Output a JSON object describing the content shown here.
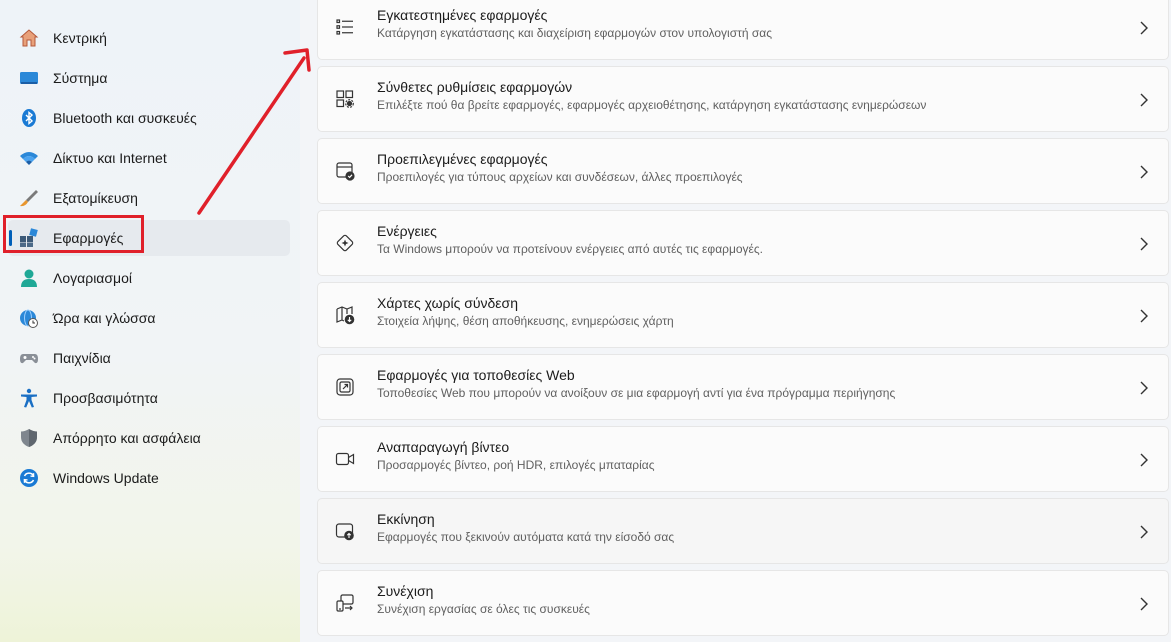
{
  "sidebar": {
    "items": [
      {
        "label": "Κεντρική",
        "icon": "home-icon"
      },
      {
        "label": "Σύστημα",
        "icon": "monitor-icon"
      },
      {
        "label": "Bluetooth και συσκευές",
        "icon": "bluetooth-icon"
      },
      {
        "label": "Δίκτυο και Internet",
        "icon": "wifi-icon"
      },
      {
        "label": "Εξατομίκευση",
        "icon": "brush-icon"
      },
      {
        "label": "Εφαρμογές",
        "icon": "apps-icon",
        "selected": true
      },
      {
        "label": "Λογαριασμοί",
        "icon": "person-icon"
      },
      {
        "label": "Ώρα και γλώσσα",
        "icon": "globe-clock-icon"
      },
      {
        "label": "Παιχνίδια",
        "icon": "gamepad-icon"
      },
      {
        "label": "Προσβασιμότητα",
        "icon": "accessibility-icon"
      },
      {
        "label": "Απόρρητο και ασφάλεια",
        "icon": "shield-icon"
      },
      {
        "label": "Windows Update",
        "icon": "update-icon"
      }
    ]
  },
  "main": {
    "cards": [
      {
        "title": "Εγκατεστημένες εφαρμογές",
        "description": "Κατάργηση εγκατάστασης και διαχείριση εφαρμογών στον υπολογιστή σας",
        "icon": "list-icon"
      },
      {
        "title": "Σύνθετες ρυθμίσεις εφαρμογών",
        "description": "Επιλέξτε πού θα βρείτε εφαρμογές, εφαρμογές αρχειοθέτησης, κατάργηση εγκατάστασης ενημερώσεων",
        "icon": "apps-settings-icon"
      },
      {
        "title": "Προεπιλεγμένες εφαρμογές",
        "description": "Προεπιλογές για τύπους αρχείων και συνδέσεων, άλλες προεπιλογές",
        "icon": "default-apps-icon"
      },
      {
        "title": "Ενέργειες",
        "description": "Τα Windows μπορούν να προτείνουν ενέργειες από αυτές τις εφαρμογές.",
        "icon": "sparkle-icon"
      },
      {
        "title": "Χάρτες χωρίς σύνδεση",
        "description": "Στοιχεία λήψης, θέση αποθήκευσης, ενημερώσεις χάρτη",
        "icon": "map-download-icon"
      },
      {
        "title": "Εφαρμογές για τοποθεσίες Web",
        "description": "Τοποθεσίες Web που μπορούν να ανοίξουν σε μια εφαρμογή αντί για ένα πρόγραμμα περιήγησης",
        "icon": "open-external-icon"
      },
      {
        "title": "Αναπαραγωγή βίντεο",
        "description": "Προσαρμογές βίντεο, ροή HDR, επιλογές μπαταρίας",
        "icon": "video-icon"
      },
      {
        "title": "Εκκίνηση",
        "description": "Εφαρμογές που ξεκινούν αυτόματα κατά την είσοδό σας",
        "icon": "startup-icon"
      },
      {
        "title": "Συνέχιση",
        "description": "Συνέχιση εργασίας σε όλες τις συσκευές",
        "icon": "devices-continue-icon"
      }
    ]
  },
  "colors": {
    "accent": "#005fb8",
    "annotation_red": "#e0202a"
  }
}
